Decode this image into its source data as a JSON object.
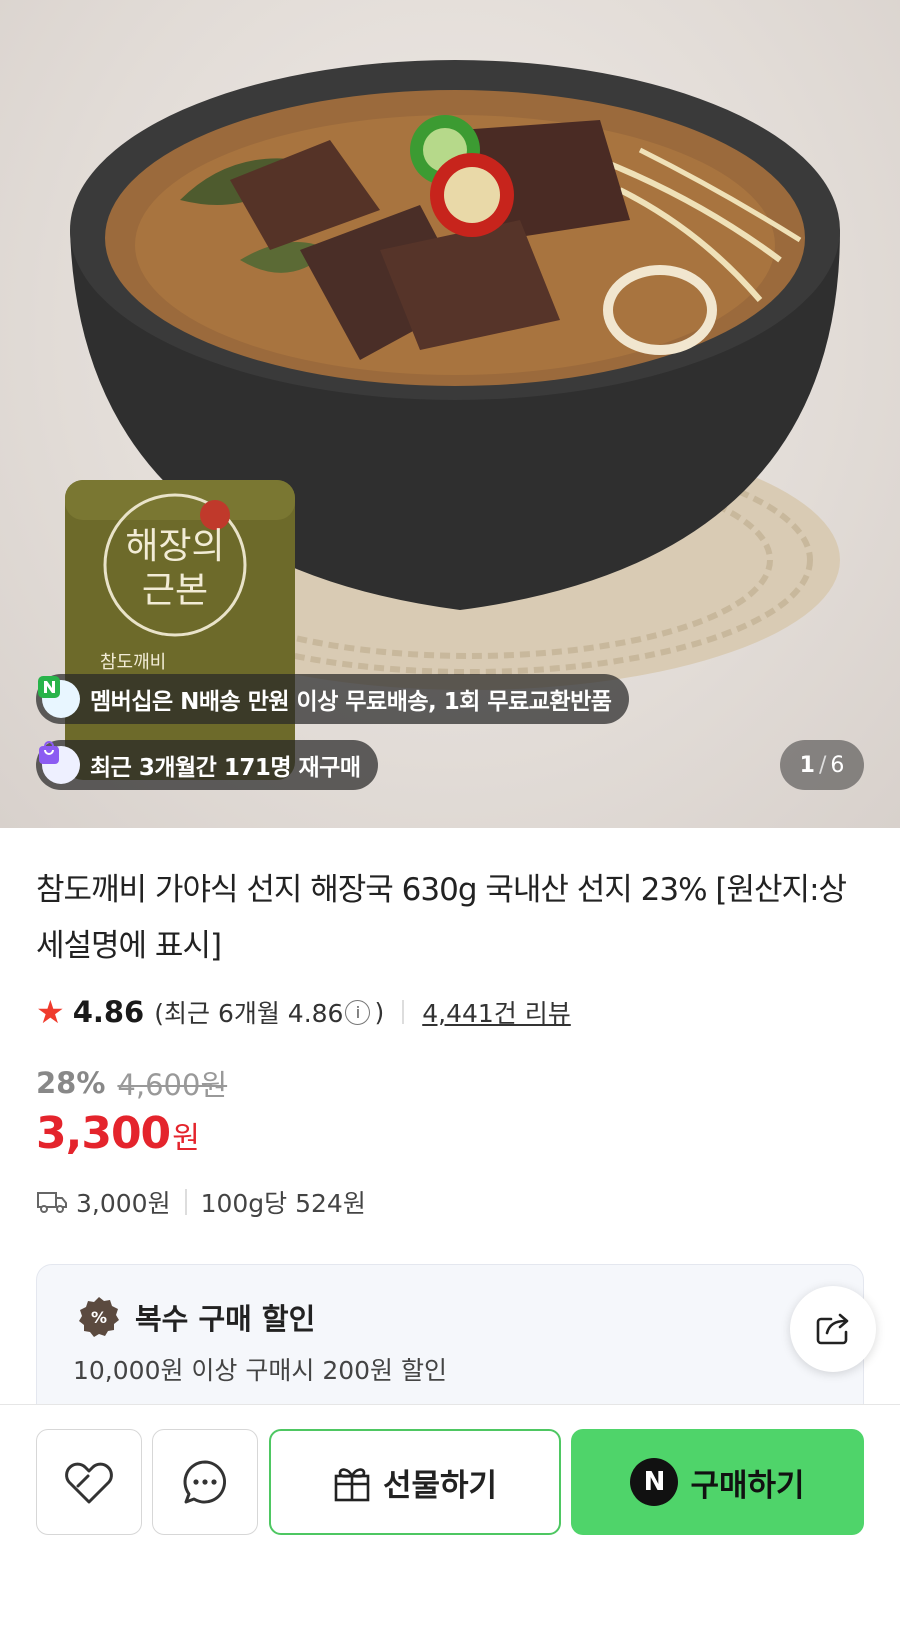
{
  "hero": {
    "badges": [
      {
        "icon": "naver-n-icon",
        "text": "멤버십은 N배송 만원 이상 무료배송, 1회 무료교환반품"
      },
      {
        "icon": "shopping-bag-icon",
        "text": "최근 3개월간 171명 재구매"
      }
    ],
    "counter": {
      "current": "1",
      "separator": "/",
      "total": "6"
    },
    "package_label": {
      "line1": "해장의",
      "line2": "근본",
      "sub": "참도깨비"
    }
  },
  "product": {
    "title": "참도깨비 가야식 선지 해장국 630g 국내산 선지 23% [원산지:상세설명에 표시]",
    "rating": {
      "star": "★",
      "score": "4.86",
      "recent_prefix": "(최근 6개월 4.86",
      "recent_suffix": ")",
      "info": "i",
      "reviews": "4,441건 리뷰"
    },
    "discount_rate": "28%",
    "original_price": "4,600원",
    "price": "3,300",
    "price_unit": "원",
    "shipping_fee": "3,000원",
    "unit_price": "100g당 524원"
  },
  "multi_buy": {
    "badge": "%",
    "title": "복수 구매 할인",
    "description": "10,000원 이상 구매시 200원 할인"
  },
  "bottom_bar": {
    "gift_label": "선물하기",
    "buy_label": "구매하기",
    "buy_logo": "N"
  },
  "colors": {
    "accent_red": "#e4242c",
    "buy_green": "#4fd46a",
    "gift_border": "#4ec762"
  }
}
